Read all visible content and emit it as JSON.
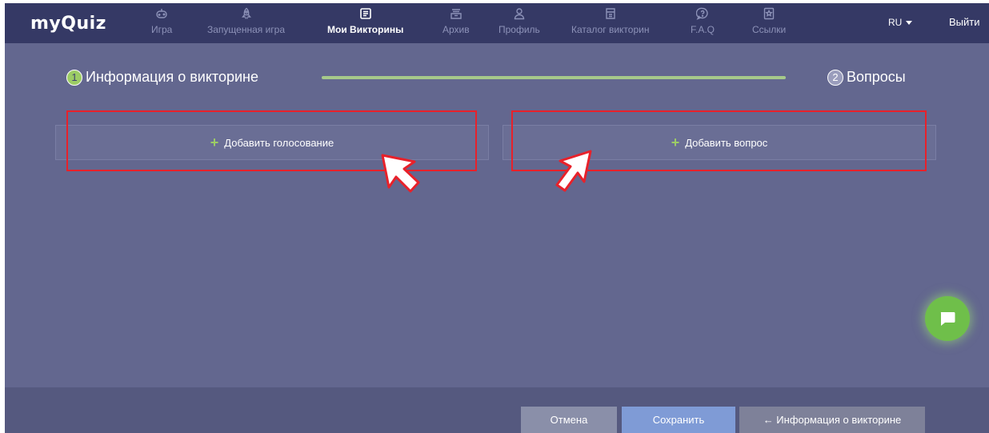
{
  "header": {
    "logo": "myQuiz",
    "nav": [
      {
        "label": "Игра",
        "icon": "gamepad-icon"
      },
      {
        "label": "Запущенная игра",
        "icon": "rocket-icon"
      },
      {
        "label": "Мои Викторины",
        "icon": "quiz-list-icon"
      },
      {
        "label": "Архив",
        "icon": "archive-icon"
      },
      {
        "label": "Профиль",
        "icon": "user-icon"
      },
      {
        "label": "Каталог викторин",
        "icon": "catalog-icon"
      },
      {
        "label": "F.A.Q",
        "icon": "help-icon"
      },
      {
        "label": "Ссылки",
        "icon": "bookmark-icon"
      }
    ],
    "active_nav": "Мои Викторины",
    "lang": "RU",
    "logout": "Выйти"
  },
  "steps": {
    "step1": {
      "num": "1",
      "label": "Информация о викторине"
    },
    "step2": {
      "num": "2",
      "label": "Вопросы"
    }
  },
  "panels": {
    "add_vote": "Добавить голосование",
    "add_question": "Добавить вопрос"
  },
  "footer": {
    "cancel": "Отмена",
    "save": "Сохранить",
    "back": "← Информация о викторине"
  },
  "colors": {
    "background": "#63678f",
    "header": "#353965",
    "accent_green": "#9ccc65",
    "highlight_red": "#e8212a",
    "save_button": "#7f9bd6"
  }
}
